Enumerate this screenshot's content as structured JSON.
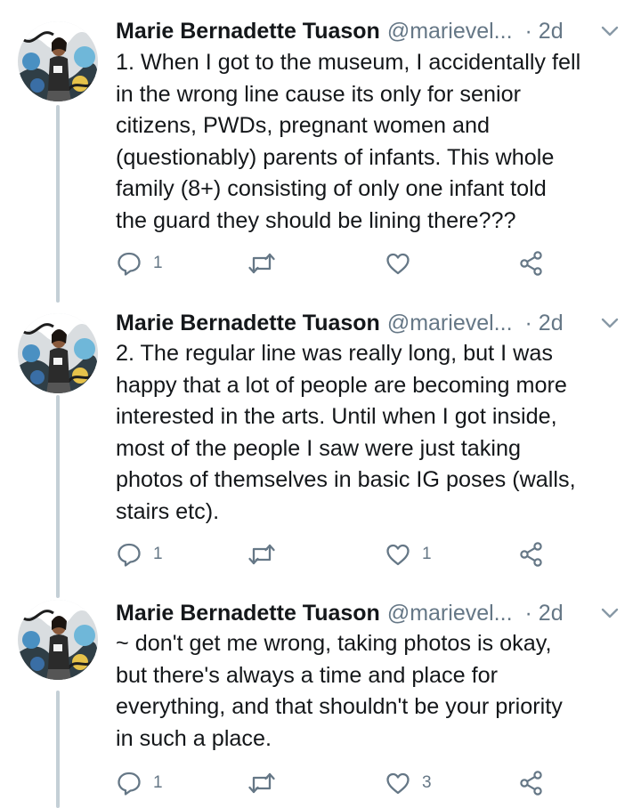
{
  "colors": {
    "text_primary": "#14171a",
    "text_secondary": "#657786",
    "thread_line": "#c4cfd6",
    "icon": "#657786"
  },
  "tweets": [
    {
      "display_name": "Marie Bernadette Tuason",
      "handle": "@marievel...",
      "time": "· 2d",
      "lines": [
        "1. When I got to the museum, I accidentally fell",
        "in the wrong line cause its only for senior",
        "citizens, PWDs, pregnant women and",
        "(questionably) parents of infants. This whole",
        "family (8+) consisting of only one infant told",
        "the guard they should be lining there???"
      ],
      "reply_count": "1",
      "retweet_count": "",
      "like_count": "",
      "icons": [
        "reply-icon",
        "retweet-icon",
        "heart-icon",
        "share-icon"
      ]
    },
    {
      "display_name": "Marie Bernadette Tuason",
      "handle": "@marievel...",
      "time": "· 2d",
      "lines": [
        "2. The regular line was really long, but I was",
        "happy that a lot of people are becoming more",
        "interested in the arts. Until when I got inside,",
        "most of the people I saw were just taking",
        "photos of themselves in basic IG poses (walls,",
        "stairs etc)."
      ],
      "reply_count": "1",
      "retweet_count": "",
      "like_count": "1",
      "icons": [
        "reply-icon",
        "retweet-icon",
        "heart-icon",
        "share-icon"
      ]
    },
    {
      "display_name": "Marie Bernadette Tuason",
      "handle": "@marievel...",
      "time": "· 2d",
      "lines": [
        "~ don't get me wrong, taking photos is okay,",
        "but there's always a time and place for",
        "everything, and that shouldn't be your priority",
        "in such a place."
      ],
      "reply_count": "1",
      "retweet_count": "",
      "like_count": "3",
      "icons": [
        "reply-icon",
        "retweet-icon",
        "heart-icon",
        "share-icon"
      ]
    }
  ]
}
